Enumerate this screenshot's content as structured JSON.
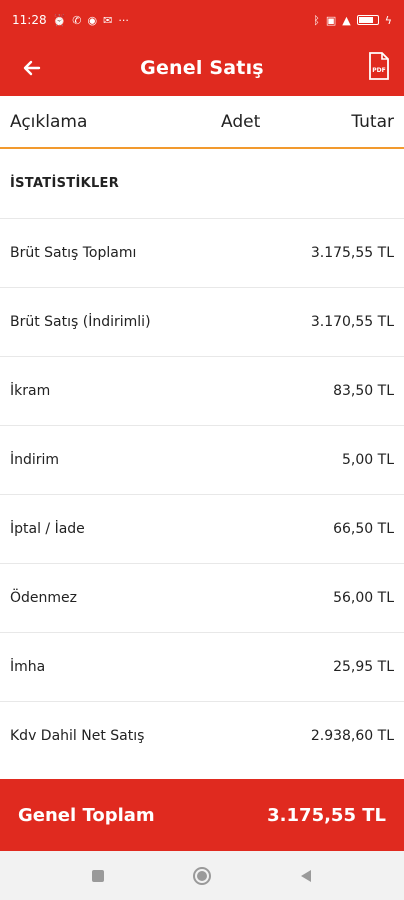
{
  "status_bar": {
    "time": "11:28",
    "left_icons": [
      "alarm-icon",
      "whatsapp-icon",
      "shield-icon",
      "mail-icon",
      "more-icon"
    ],
    "right_icons": [
      "bluetooth-icon",
      "nfc-icon",
      "wifi-icon",
      "battery-icon",
      "charging-icon"
    ],
    "more": "···"
  },
  "app_bar": {
    "title": "Genel Satış",
    "back_icon": "back-arrow-icon",
    "pdf_icon": "pdf-icon",
    "pdf_label": "PDF"
  },
  "columns": {
    "description": "Açıklama",
    "quantity": "Adet",
    "amount": "Tutar"
  },
  "section": {
    "title": "İSTATİSTİKLER"
  },
  "rows": [
    {
      "label": "Brüt Satış Toplamı",
      "value": "3.175,55 TL"
    },
    {
      "label": "Brüt Satış (İndirimli)",
      "value": "3.170,55 TL"
    },
    {
      "label": "İkram",
      "value": "83,50 TL"
    },
    {
      "label": "İndirim",
      "value": "5,00 TL"
    },
    {
      "label": "İptal / İade",
      "value": "66,50 TL"
    },
    {
      "label": "Ödenmez",
      "value": "56,00 TL"
    },
    {
      "label": "İmha",
      "value": "25,95 TL"
    },
    {
      "label": "Kdv Dahil Net Satış",
      "value": "2.938,60 TL"
    }
  ],
  "footer": {
    "label": "Genel Toplam",
    "total": "3.175,55 TL"
  },
  "nav": [
    "recents-icon",
    "home-icon",
    "back-icon"
  ],
  "colors": {
    "primary": "#e02a1f",
    "accent_line": "#f29a2e"
  }
}
